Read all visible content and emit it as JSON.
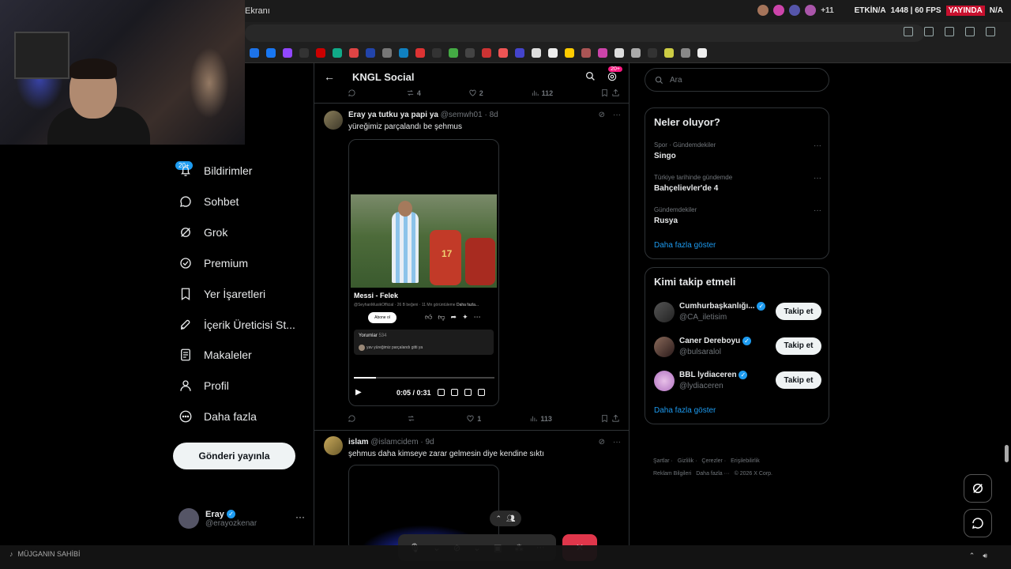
{
  "browser": {
    "tab_title": "Ekranı",
    "stream_status": [
      "ETKİN/A",
      "1448 | 60 FPS",
      "YAYINDA",
      "N/A"
    ],
    "avatar_overflow": "+11"
  },
  "app": {
    "header_title": "KNGL Social",
    "notif_count": "20+",
    "accent": "#1d9bf0"
  },
  "nav": {
    "notif_badge": "20+",
    "items": [
      {
        "label": "Bildirimler",
        "icon": "bell-icon"
      },
      {
        "label": "Sohbet",
        "icon": "chat-icon"
      },
      {
        "label": "Grok",
        "icon": "grok-icon"
      },
      {
        "label": "Premium",
        "icon": "premium-icon"
      },
      {
        "label": "Yer İşaretleri",
        "icon": "bookmark-icon"
      },
      {
        "label": "İçerik Üreticisi St...",
        "icon": "rocket-icon"
      },
      {
        "label": "Makaleler",
        "icon": "article-icon"
      },
      {
        "label": "Profil",
        "icon": "person-icon"
      },
      {
        "label": "Daha fazla",
        "icon": "more-circle-icon"
      }
    ],
    "post_button": "Gönderi yayınla",
    "account": {
      "name": "Eray",
      "handle": "@erayozkenar",
      "more": "···"
    }
  },
  "prev_tweet_actions": {
    "reply": "",
    "retweet": "4",
    "like": "2",
    "views": "112"
  },
  "tweets": [
    {
      "author": "Eray ya tutku ya papi ya",
      "handle": "@semwh01",
      "time": "8d",
      "text": "yüreğimiz parçalandı be şehmus",
      "video": {
        "title": "Messi - Felek",
        "sub": "@SeyhanMusikOfficial · 26 B beğeni · 11 Mn görüntüleme",
        "more": "Daha fazla...",
        "subscribe": "Abone ol",
        "jersey_number": "17",
        "comments_label": "Yorumlar",
        "comments_count": "534",
        "comment_text": "yav yüreğimiz parçalandı gitti ya",
        "time": "0:05 / 0:31",
        "progress": 0.16
      },
      "actions": {
        "reply": "",
        "retweet": "",
        "like": "1",
        "views": "113"
      }
    },
    {
      "author": "islam",
      "handle": "@islamcidem",
      "time": "9d",
      "text": "şehmus daha kimseye zarar gelmesin diye kendine sıktı"
    }
  ],
  "right": {
    "search_placeholder": "Ara",
    "trends_title": "Neler oluyor?",
    "trends": [
      {
        "category": "Spor · Gündemdekiler",
        "topic": "Singo"
      },
      {
        "category": "Türkiye tarihinde gündemde",
        "topic": "Bahçelievler'de 4"
      },
      {
        "category": "Gündemdekiler",
        "topic": "Rusya"
      }
    ],
    "trends_more": "Daha fazla göster",
    "follow_title": "Kimi takip etmeli",
    "follow": [
      {
        "name": "Cumhurbaşkanlığı...",
        "handle": "@CA_iletisim",
        "button": "Takip et"
      },
      {
        "name": "Caner Dereboyu",
        "handle": "@bulsaralol",
        "button": "Takip et"
      },
      {
        "name": "BBL lydiaceren",
        "handle": "@lydiaceren",
        "button": "Takip et"
      }
    ],
    "follow_more": "Daha fazla göster",
    "footer": [
      "Şartlar",
      "Gizlilik",
      "Çerezler",
      "Erişilebilirlik",
      "Reklam Bilgileri",
      "Daha fazla ···",
      "© 2026 X Corp."
    ]
  },
  "taskbar": {
    "status_label": "MÜJGANIN SAHİBİ"
  }
}
